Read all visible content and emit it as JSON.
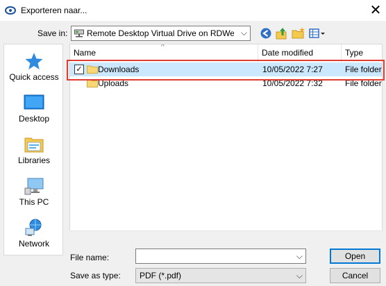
{
  "window": {
    "title": "Exporteren naar...",
    "close_glyph": "✕"
  },
  "toolbar": {
    "save_in_label": "Save in:",
    "save_in_value": "Remote Desktop Virtual Drive on RDWebClient",
    "dropdown_glyph": "⌵",
    "icons": [
      "back-icon",
      "up-folder-icon",
      "new-folder-icon",
      "view-menu-icon"
    ]
  },
  "places": [
    {
      "label": "Quick access",
      "icon": "star-icon"
    },
    {
      "label": "Desktop",
      "icon": "desktop-icon"
    },
    {
      "label": "Libraries",
      "icon": "libraries-icon"
    },
    {
      "label": "This PC",
      "icon": "pc-icon"
    },
    {
      "label": "Network",
      "icon": "network-icon"
    }
  ],
  "filelist": {
    "columns": {
      "name": "Name",
      "date": "Date modified",
      "type": "Type"
    },
    "sort_glyph": "^",
    "rows": [
      {
        "name": "Downloads",
        "date": "10/05/2022 7:27",
        "type": "File folder",
        "selected": true,
        "checked": "✓"
      },
      {
        "name": "Uploads",
        "date": "10/05/2022 7:32",
        "type": "File folder",
        "selected": false
      }
    ]
  },
  "form": {
    "file_name_label": "File name:",
    "file_name_value": "",
    "save_type_label": "Save as type:",
    "save_type_value": "PDF (*.pdf)",
    "open_label": "Open",
    "cancel_label": "Cancel"
  },
  "colors": {
    "selection": "#cce8ff",
    "highlight_box": "#e03c31",
    "accent": "#0078d7"
  }
}
